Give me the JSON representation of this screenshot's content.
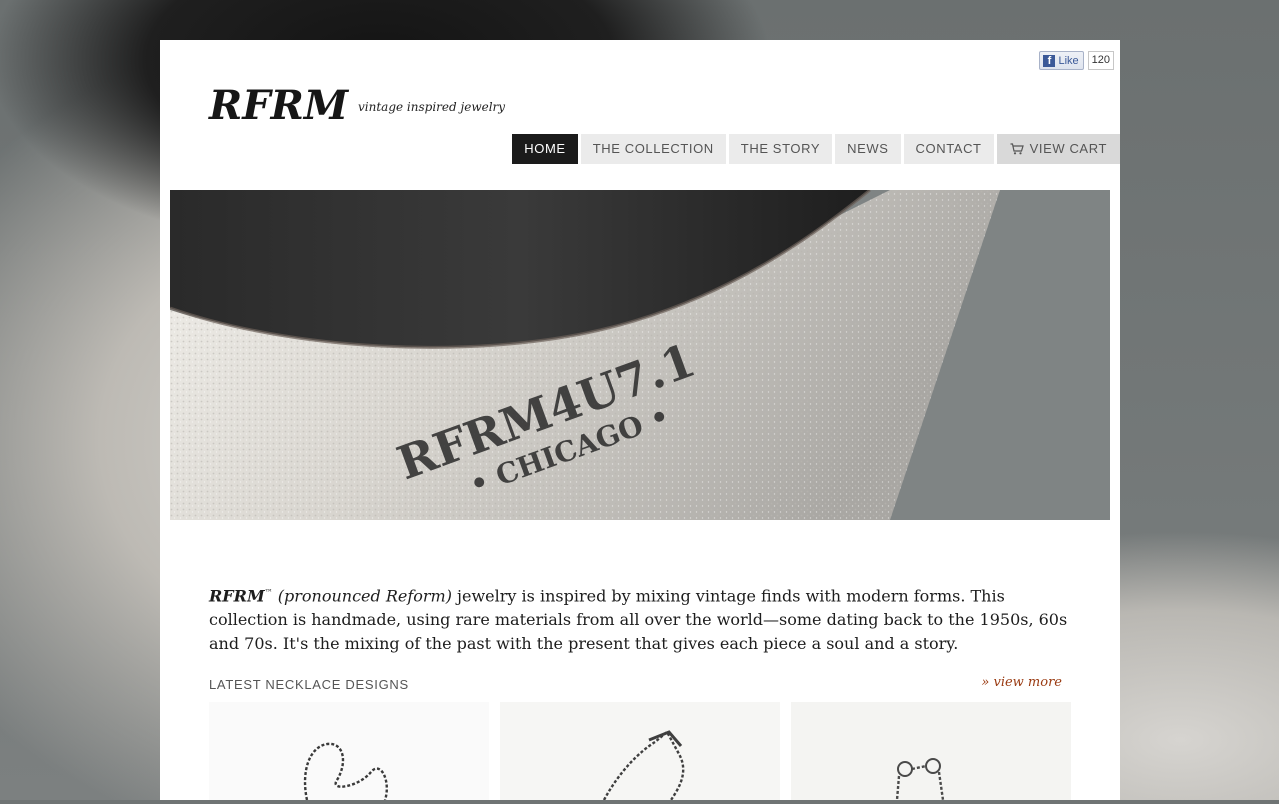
{
  "social": {
    "like_label": "Like",
    "like_count": "120"
  },
  "brand": {
    "logo": "RFRM",
    "tagline": "vintage inspired jewelry"
  },
  "nav": {
    "items": [
      {
        "label": "HOME",
        "active": true
      },
      {
        "label": "THE COLLECTION"
      },
      {
        "label": "THE STORY"
      },
      {
        "label": "NEWS"
      },
      {
        "label": "CONTACT"
      },
      {
        "label": "VIEW CART"
      }
    ]
  },
  "hero": {
    "stamp_line1": "RFRM4U7.1",
    "stamp_line2": "• CHICAGO •"
  },
  "intro": {
    "brand": "RFRM",
    "tm": "™",
    "pronounced": "(pronounced Reform)",
    "text": " jewelry is inspired by mixing vintage finds with modern forms. This collection is handmade, using rare materials from all over the world—some dating back to the 1950s, 60s and 70s. It's the mixing of the past with the present that gives each piece a soul and a story."
  },
  "latest": {
    "title": "LATEST NECKLACE DESIGNS",
    "view_more": "» view more"
  },
  "colors": {
    "accent_link": "#9a3b12",
    "nav_active_bg": "#1b1b1b",
    "nav_bg": "#ebebeb"
  }
}
